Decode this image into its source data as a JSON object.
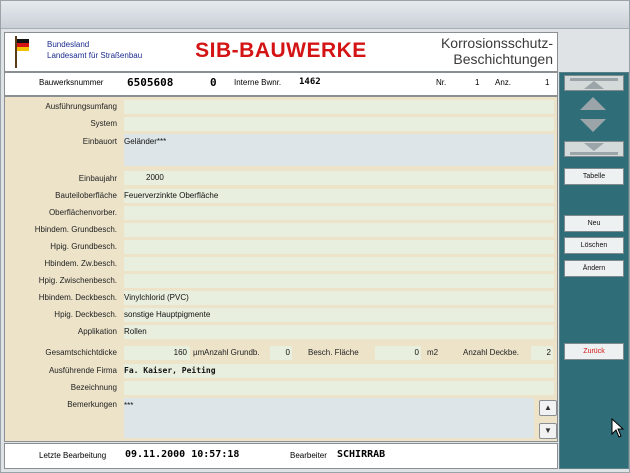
{
  "header": {
    "agency_line1": "Bundesland",
    "agency_line2": "Landesamt für Straßenbau",
    "app_title": "SIB-BAUWERKE",
    "module_title_line1": "Korrosionsschutz-",
    "module_title_line2": "Beschichtungen"
  },
  "idbar": {
    "bauwerksnummer_label": "Bauwerksnummer",
    "bauwerksnummer": "6505608",
    "teil": "0",
    "interne_label": "Interne Bwnr.",
    "interne": "1462",
    "nr_label": "Nr.",
    "nr": "1",
    "anz_label": "Anz.",
    "anz": "1"
  },
  "form": {
    "rows": [
      {
        "label": "Ausführungsumfang",
        "value": ""
      },
      {
        "label": "System",
        "value": ""
      },
      {
        "label": "Einbauort",
        "value": "Geländer***"
      },
      {
        "label": "Einbaujahr",
        "value": "2000"
      },
      {
        "label": "Bauteiloberfläche",
        "value": "Feuerverzinkte Oberfläche"
      },
      {
        "label": "Oberflächenvorber.",
        "value": ""
      },
      {
        "label": "Hbindem. Grundbesch.",
        "value": ""
      },
      {
        "label": "Hpig. Grundbesch.",
        "value": ""
      },
      {
        "label": "Hbindem. Zw.besch.",
        "value": ""
      },
      {
        "label": "Hpig. Zwischenbesch.",
        "value": ""
      },
      {
        "label": "Hbindem. Deckbesch.",
        "value": "Vinylchlorid (PVC)"
      },
      {
        "label": "Hpig. Deckbesch.",
        "value": "sonstige Hauptpigmente"
      },
      {
        "label": "Applikation",
        "value": "Rollen"
      }
    ],
    "gesamt_label": "Gesamtschichtdicke",
    "gesamt_value": "160",
    "gesamt_unit": "µm",
    "anzahl_grund_label": "Anzahl Grundb.",
    "anzahl_grund_value": "0",
    "besch_flaeche_label": "Besch. Fläche",
    "besch_flaeche_value": "0",
    "besch_flaeche_unit": "m2",
    "anzahl_deck_label": "Anzahl Deckbe.",
    "anzahl_deck_value": "2",
    "firma_label": "Ausführende Firma",
    "firma_value": "Fa. Kaiser, Peiting",
    "bezeichnung_label": "Bezeichnung",
    "bezeichnung_value": "",
    "bemerkungen_label": "Bemerkungen",
    "bemerkungen_value": "***"
  },
  "footer": {
    "letzte_label": "Letzte Bearbeitung",
    "letzte_value": "09.11.2000 10:57:18",
    "bearbeiter_label": "Bearbeiter",
    "bearbeiter_value": "SCHIRRAB"
  },
  "rightpanel": {
    "tabelle": "Tabelle",
    "neu": "Neu",
    "loeschen": "Löschen",
    "aendern": "Ändern",
    "zurueck": "Zurück"
  },
  "icons": {
    "flag": "flag-icon",
    "scroll_up": "scroll-up-icon",
    "scroll_down": "scroll-down-icon"
  },
  "colors": {
    "title_red": "#d41414",
    "panel_teal": "#2f6e78",
    "form_bg": "#ece3c9"
  }
}
